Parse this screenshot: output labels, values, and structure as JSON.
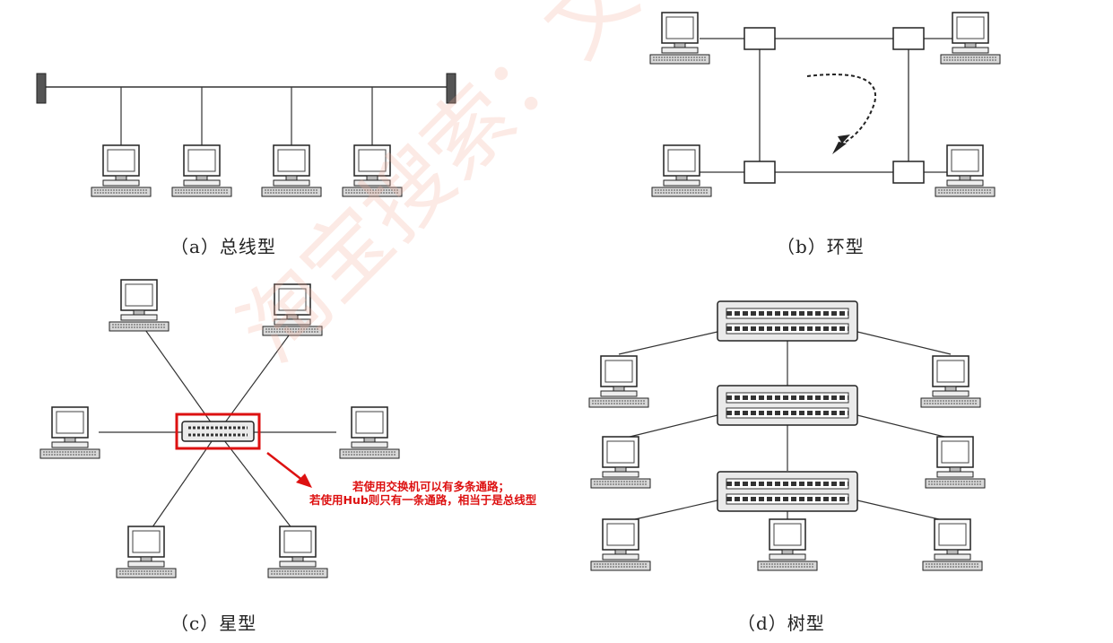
{
  "captions": {
    "bus": "（a）总线型",
    "ring": "（b）环型",
    "star": "（c）星型",
    "tree": "（d）树型"
  },
  "annotation": {
    "line1": "若使用交换机可以有多条通路；",
    "line2": "若使用Hub则只有一条通路，相当于是总线型"
  },
  "watermark": "淘宝搜索：文老师网络工程师",
  "colors": {
    "annotation": "#dd1111",
    "highlight": "#dd1111",
    "line": "#333333"
  }
}
